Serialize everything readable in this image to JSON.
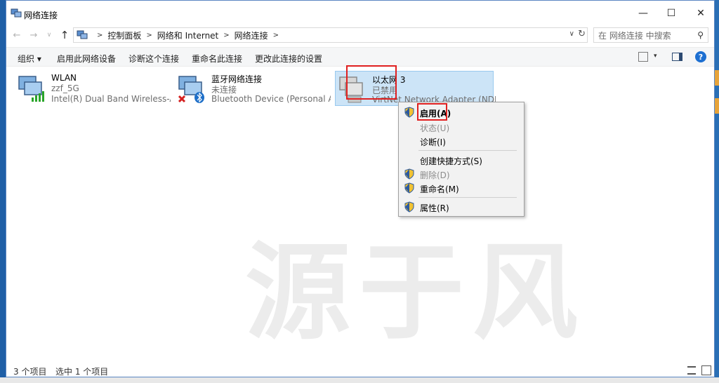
{
  "window": {
    "title": "网络连接"
  },
  "nav": {
    "back": "←",
    "forward": "→",
    "recent": "∨",
    "up": "↑"
  },
  "address": {
    "crumbs": [
      "控制面板",
      "网络和 Internet",
      "网络连接"
    ],
    "separator": ">"
  },
  "search": {
    "placeholder": "在 网络连接 中搜索"
  },
  "toolbar": {
    "organize": "组织 ▾",
    "enable_device": "启用此网络设备",
    "diagnose": "诊断这个连接",
    "rename": "重命名此连接",
    "change_settings": "更改此连接的设置",
    "help": "?"
  },
  "adapters": [
    {
      "name": "WLAN",
      "status": "zzf_5G",
      "device": "Intel(R) Dual Band Wireless-AC..."
    },
    {
      "name": "蓝牙网络连接",
      "status": "未连接",
      "device": "Bluetooth Device (Personal Ar..."
    },
    {
      "name": "以太网 3",
      "status": "已禁用",
      "device": "VirtNet Network Adapter (NDI..."
    }
  ],
  "context_menu": {
    "enable": "启用(A)",
    "status": "状态(U)",
    "diagnose": "诊断(I)",
    "shortcut": "创建快捷方式(S)",
    "delete": "删除(D)",
    "rename": "重命名(M)",
    "properties": "属性(R)"
  },
  "statusbar": {
    "count": "3 个项目",
    "selected": "选中 1 个项目"
  },
  "watermark": "源于风",
  "colors": {
    "accent": "#1d6fd1",
    "selection": "#cce4f7",
    "highlight_box": "#e02020"
  }
}
